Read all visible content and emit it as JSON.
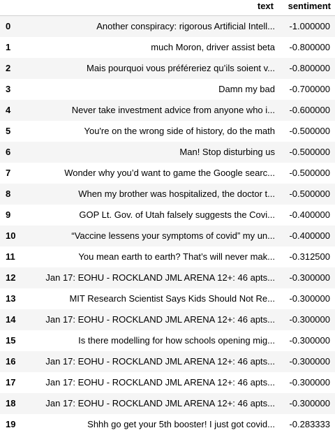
{
  "table": {
    "columns": [
      "",
      "text",
      "sentiment"
    ],
    "rows": [
      {
        "index": "0",
        "text": "Another conspiracy: rigorous Artificial Intell...",
        "sentiment": "-1.000000"
      },
      {
        "index": "1",
        "text": "much Moron, driver assist beta",
        "sentiment": "-0.800000"
      },
      {
        "index": "2",
        "text": "Mais pourquoi vous préféreriez qu’ils soient v...",
        "sentiment": "-0.800000"
      },
      {
        "index": "3",
        "text": "Damn my bad",
        "sentiment": "-0.700000"
      },
      {
        "index": "4",
        "text": "Never take investment advice from anyone who i...",
        "sentiment": "-0.600000"
      },
      {
        "index": "5",
        "text": "You're on the wrong side of history, do the math",
        "sentiment": "-0.500000"
      },
      {
        "index": "6",
        "text": "Man! Stop disturbing us",
        "sentiment": "-0.500000"
      },
      {
        "index": "7",
        "text": "Wonder why you’d want to game the Google searc...",
        "sentiment": "-0.500000"
      },
      {
        "index": "8",
        "text": "When my brother was hospitalized, the doctor t...",
        "sentiment": "-0.500000"
      },
      {
        "index": "9",
        "text": "GOP Lt. Gov. of Utah falsely suggests the Covi...",
        "sentiment": "-0.400000"
      },
      {
        "index": "10",
        "text": "“Vaccine lessens your symptoms of covid” my un...",
        "sentiment": "-0.400000"
      },
      {
        "index": "11",
        "text": "You mean earth to earth? That’s will never mak...",
        "sentiment": "-0.312500"
      },
      {
        "index": "12",
        "text": "Jan 17: EOHU - ROCKLAND JML ARENA 12+: 46 apts...",
        "sentiment": "-0.300000"
      },
      {
        "index": "13",
        "text": "MIT Research Scientist Says Kids Should Not Re...",
        "sentiment": "-0.300000"
      },
      {
        "index": "14",
        "text": "Jan 17: EOHU - ROCKLAND JML ARENA 12+: 46 apts...",
        "sentiment": "-0.300000"
      },
      {
        "index": "15",
        "text": "Is there modelling for how schools opening mig...",
        "sentiment": "-0.300000"
      },
      {
        "index": "16",
        "text": "Jan 17: EOHU - ROCKLAND JML ARENA 12+: 46 apts...",
        "sentiment": "-0.300000"
      },
      {
        "index": "17",
        "text": "Jan 17: EOHU - ROCKLAND JML ARENA 12+: 46 apts...",
        "sentiment": "-0.300000"
      },
      {
        "index": "18",
        "text": "Jan 17: EOHU - ROCKLAND JML ARENA 12+: 46 apts...",
        "sentiment": "-0.300000"
      },
      {
        "index": "19",
        "text": "Shhh go get your 5th booster! I just got covid...",
        "sentiment": "-0.283333"
      }
    ]
  }
}
